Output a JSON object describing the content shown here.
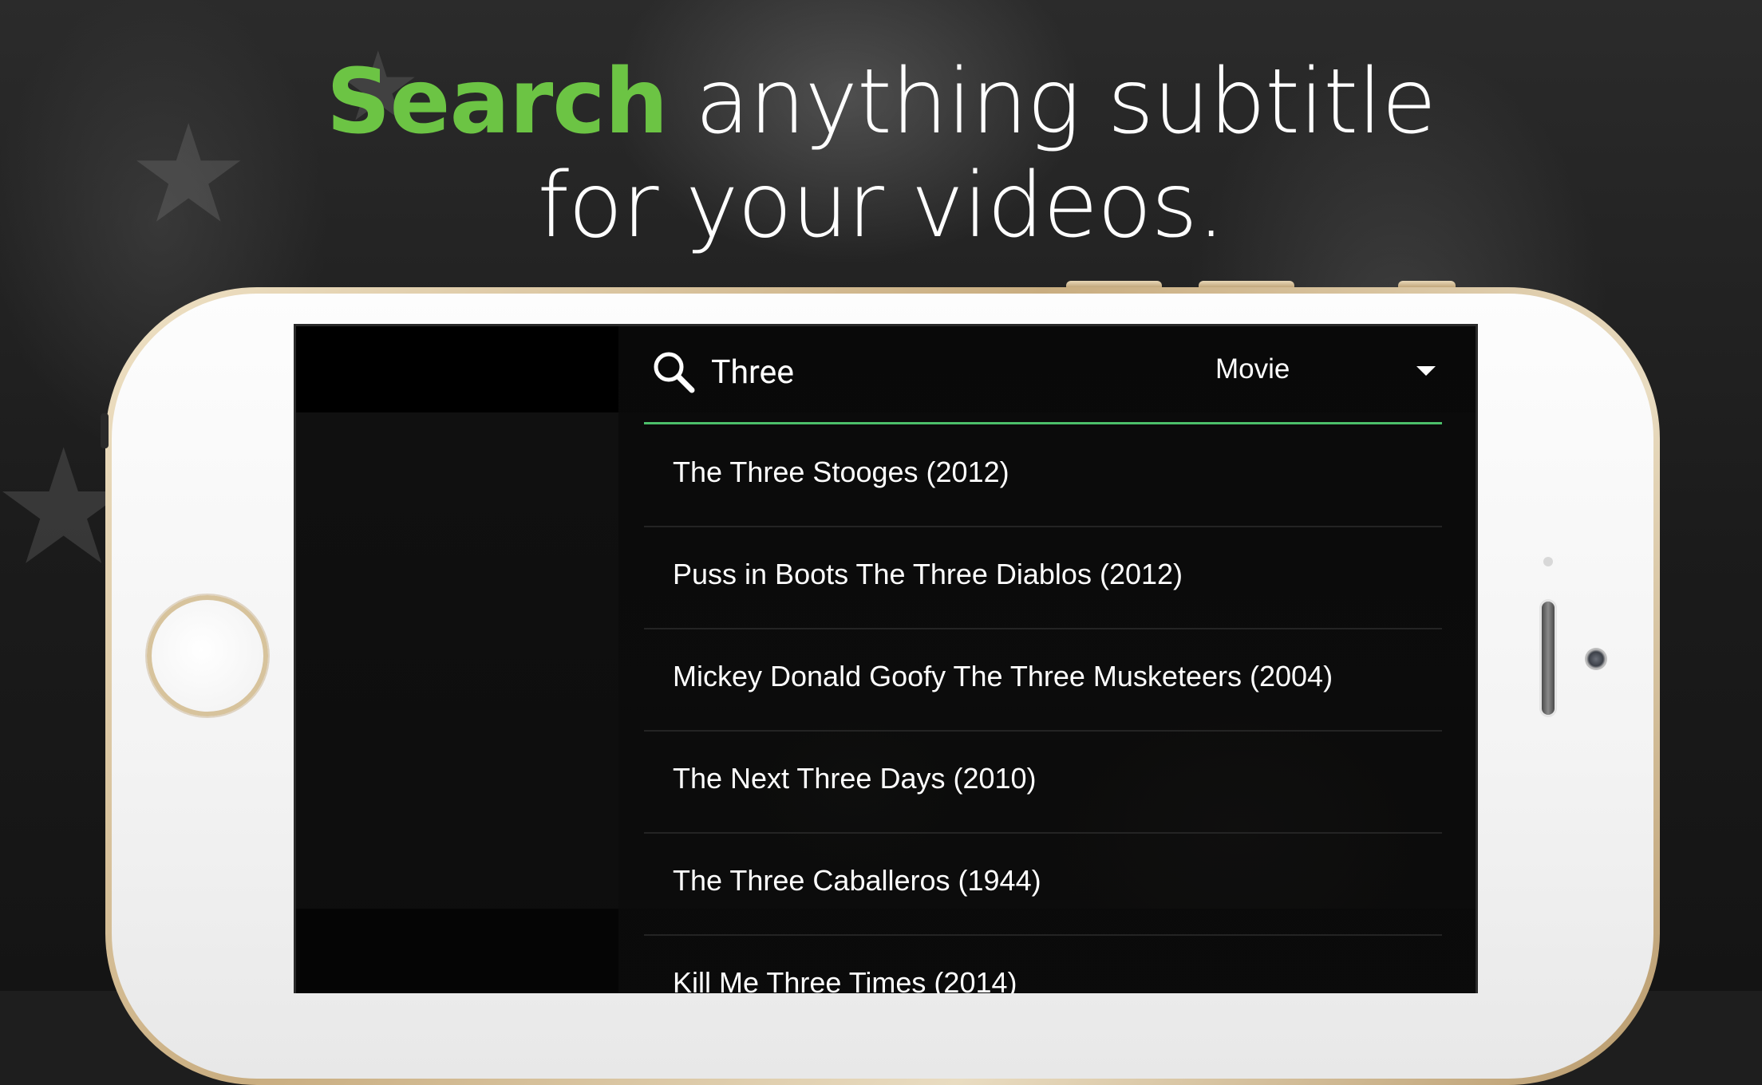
{
  "headline": {
    "highlight": "Search",
    "line1_rest": " anything subtitle",
    "line2": "for your videos."
  },
  "colors": {
    "accent": "#6cc444",
    "underline": "#4cbf6a",
    "phone_gold": "#c9ad80"
  },
  "search": {
    "icon": "search-icon",
    "query": "Three",
    "type_selected": "Movie",
    "type_icon": "chevron-down-icon"
  },
  "results": [
    "The Three Stooges (2012)",
    "Puss in Boots The Three Diablos (2012)",
    "Mickey Donald Goofy The Three Musketeers (2004)",
    "The Next Three Days (2010)",
    "The Three Caballeros (1944)",
    "Kill Me Three Times (2014)"
  ]
}
